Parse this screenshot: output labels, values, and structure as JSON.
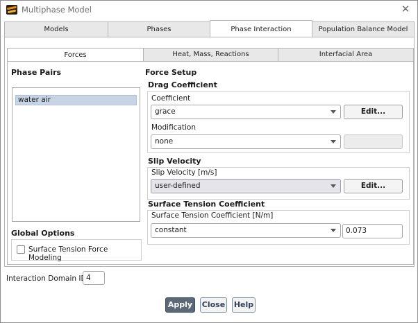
{
  "window": {
    "title": "Multiphase Model"
  },
  "top_tabs": [
    {
      "label": "Models"
    },
    {
      "label": "Phases"
    },
    {
      "label": "Phase Interaction"
    },
    {
      "label": "Population Balance Model"
    }
  ],
  "active_top_tab": "Phase Interaction",
  "sub_tabs": [
    {
      "label": "Forces"
    },
    {
      "label": "Heat, Mass, Reactions"
    },
    {
      "label": "Interfacial Area"
    }
  ],
  "active_sub_tab": "Forces",
  "phase_pairs": {
    "title": "Phase Pairs",
    "items": [
      "water air"
    ],
    "selected": "water air"
  },
  "global_options": {
    "title": "Global Options",
    "surface_tension_label": "Surface Tension Force Modeling",
    "surface_tension_checked": false
  },
  "force_setup": {
    "title": "Force Setup",
    "drag": {
      "title": "Drag Coefficient",
      "coefficient_label": "Coefficient",
      "coefficient_value": "grace",
      "edit_label": "Edit...",
      "modification_label": "Modification",
      "modification_value": "none"
    },
    "slip": {
      "title": "Slip Velocity",
      "label": "Slip Velocity [m/s]",
      "value": "user-defined",
      "edit_label": "Edit..."
    },
    "surface_tension": {
      "title": "Surface Tension Coefficient",
      "label": "Surface Tension Coefficient [N/m]",
      "method": "constant",
      "value": "0.073"
    }
  },
  "interaction_domain": {
    "label": "Interaction Domain ID",
    "value": "4"
  },
  "buttons": {
    "apply": "Apply",
    "close": "Close",
    "help": "Help"
  },
  "colors": {
    "selected_item": "#c6d4e6",
    "primary_button": "#5b6878",
    "tab_inactive": "#e8e8e8"
  }
}
